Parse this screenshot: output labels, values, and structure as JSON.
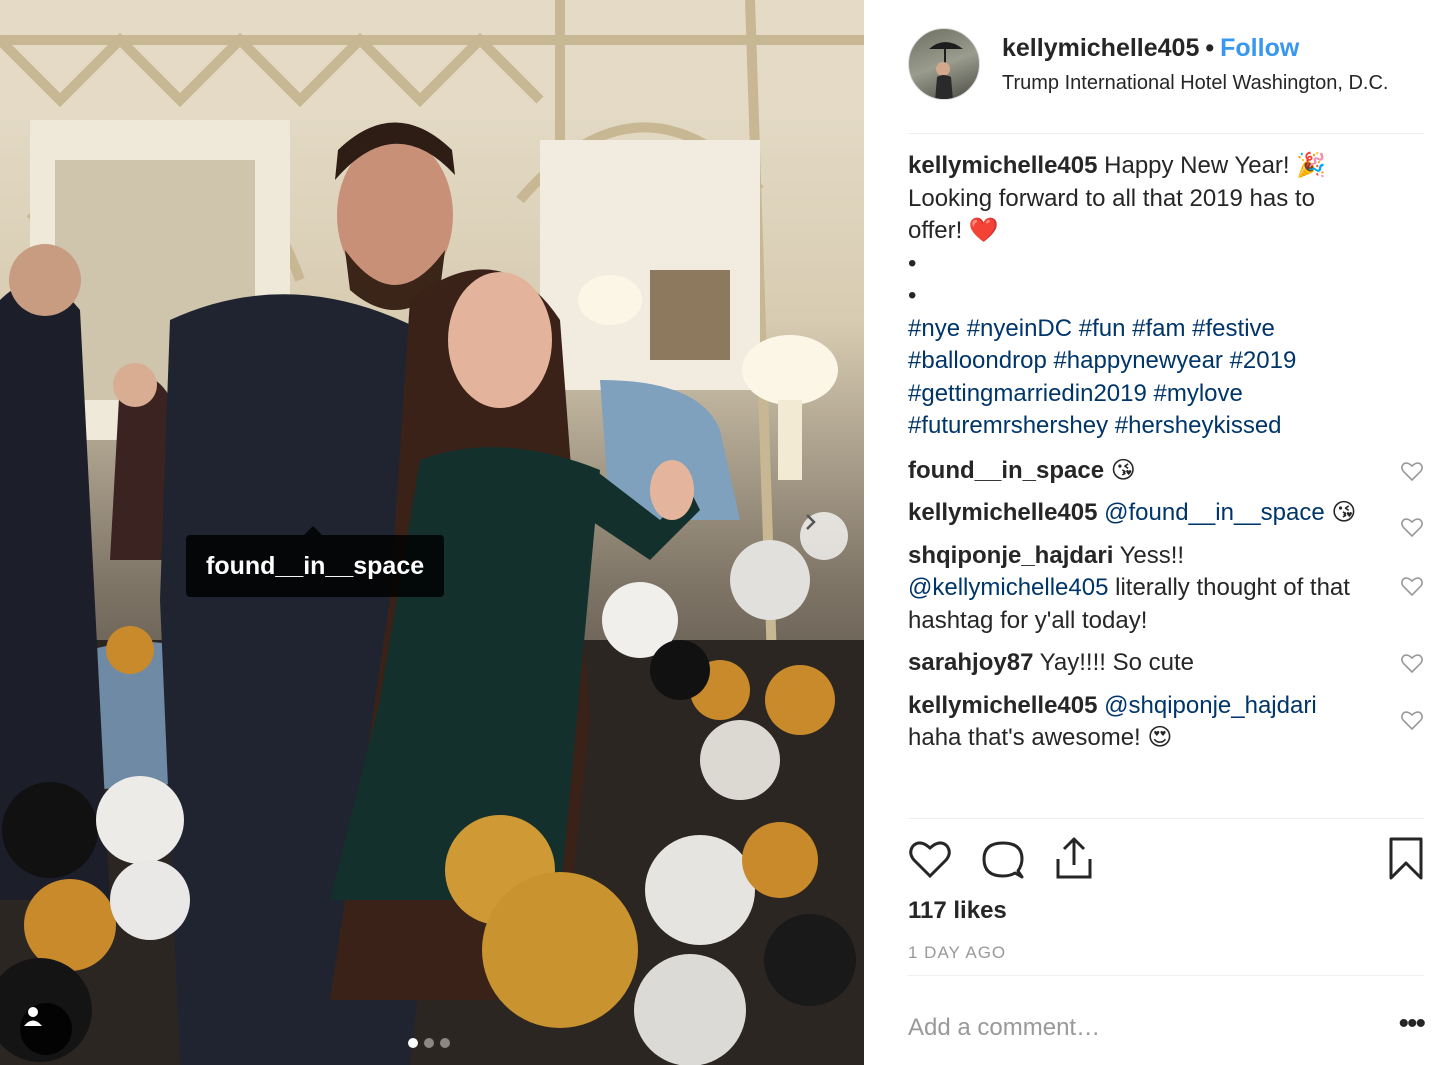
{
  "post": {
    "username": "kellymichelle405",
    "separator": "•",
    "follow_label": "Follow",
    "location": "Trump International Hotel Washington, D.C."
  },
  "photo": {
    "tag_label": "found__in__space",
    "carousel_count": 3,
    "carousel_active_index": 0
  },
  "caption": {
    "username": "kellymichelle405",
    "text_line1": "Happy New Year! 🎉",
    "text_line2": "Looking forward to all that 2019 has to offer! ❤️",
    "bullet1": "•",
    "bullet2": "•",
    "hashtags": "#nye #nyeinDC #fun #fam #festive #balloondrop #happynewyear #2019 #gettingmarriedin2019 #mylove #futuremrshershey #hersheykissed"
  },
  "comments": [
    {
      "user": "found__in_space",
      "mention": "",
      "text": "😘"
    },
    {
      "user": "kellymichelle405",
      "mention": "@found__in__space",
      "text": "😘"
    },
    {
      "user": "shqiponje_hajdari",
      "mention": "",
      "text": "Yess!!",
      "mention2": "@kellymichelle405",
      "text2": "literally thought of that hashtag for y'all today!"
    },
    {
      "user": "sarahjoy87",
      "mention": "",
      "text": "Yay!!!! So cute"
    },
    {
      "user": "kellymichelle405",
      "mention": "@shqiponje_hajdari",
      "text": "haha that's awesome! 😍"
    }
  ],
  "likes": "117 likes",
  "date": "1 DAY AGO",
  "add_comment_placeholder": "Add a comment…",
  "more_label": "•••",
  "icons": {
    "like": "heart-icon",
    "comment": "comment-icon",
    "share": "share-icon",
    "save": "bookmark-icon",
    "next": "chevron-right-icon",
    "tagged_user": "person-icon"
  }
}
